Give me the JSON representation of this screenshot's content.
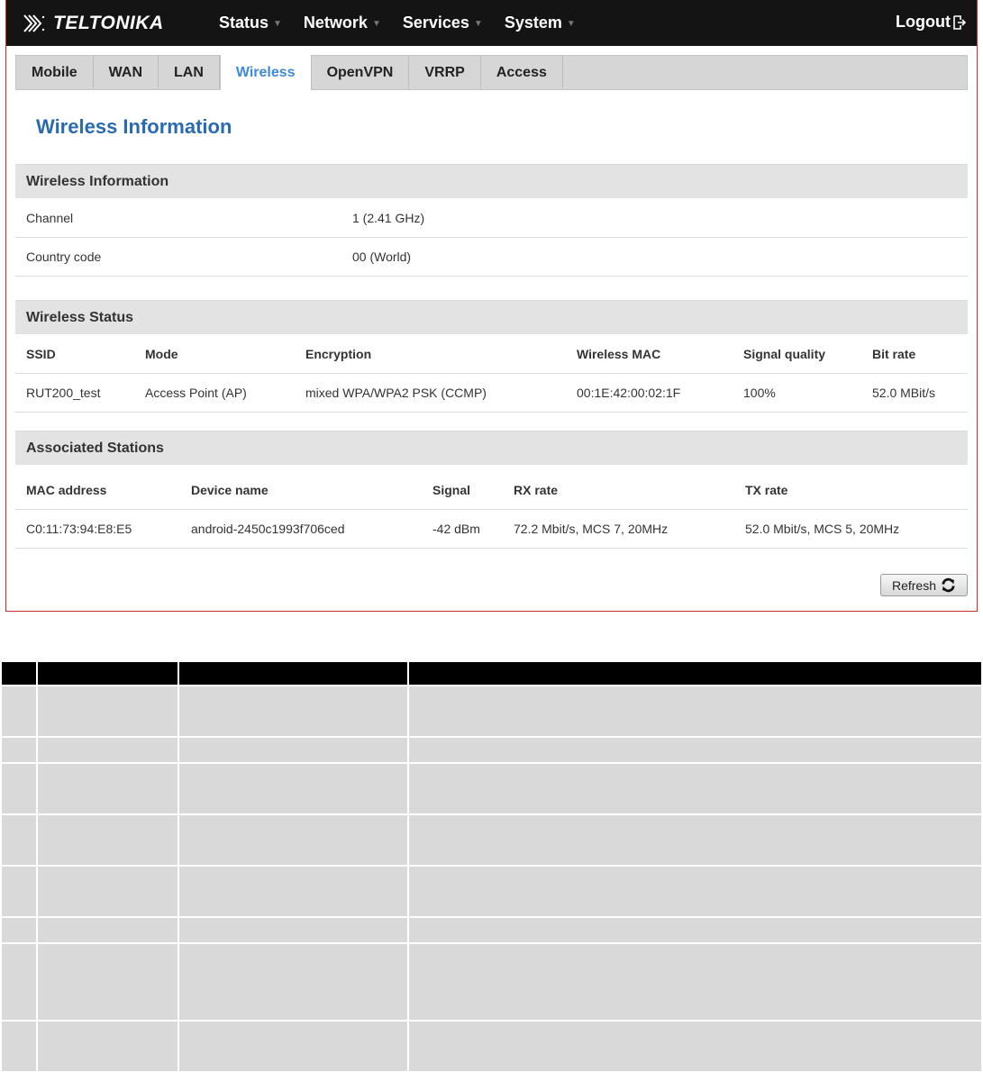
{
  "navbar": {
    "logo_text": "TELTONIKA",
    "menu": [
      {
        "label": "Status"
      },
      {
        "label": "Network"
      },
      {
        "label": "Services"
      },
      {
        "label": "System"
      }
    ],
    "logout_label": "Logout"
  },
  "tabs": [
    {
      "label": "Mobile",
      "active": false
    },
    {
      "label": "WAN",
      "active": false
    },
    {
      "label": "LAN",
      "active": false
    },
    {
      "label": "Wireless",
      "active": true
    },
    {
      "label": "OpenVPN",
      "active": false
    },
    {
      "label": "VRRP",
      "active": false
    },
    {
      "label": "Access",
      "active": false
    }
  ],
  "page_title": "Wireless Information",
  "wireless_info": {
    "heading": "Wireless Information",
    "channel_label": "Channel",
    "channel_value": "1 (2.41 GHz)",
    "country_label": "Country code",
    "country_value": "00 (World)"
  },
  "wireless_status": {
    "heading": "Wireless Status",
    "columns": [
      "SSID",
      "Mode",
      "Encryption",
      "Wireless MAC",
      "Signal quality",
      "Bit rate"
    ],
    "row": [
      "RUT200_test",
      "Access Point (AP)",
      "mixed WPA/WPA2 PSK (CCMP)",
      "00:1E:42:00:02:1F",
      "100%",
      "52.0 MBit/s"
    ]
  },
  "stations": {
    "heading": "Associated Stations",
    "columns": [
      "MAC address",
      "Device name",
      "Signal",
      "RX rate",
      "TX rate"
    ],
    "row": [
      "C0:11:73:94:E8:E5",
      "android-2450c1993f706ced",
      "-42 dBm",
      "72.2 Mbit/s, MCS 7, 20MHz",
      "52.0 Mbit/s, MCS 5, 20MHz"
    ]
  },
  "refresh_label": "Refresh",
  "colors": {
    "navbar_bg": "#141414",
    "accent_blue": "#3c8ad8",
    "title_blue": "#2a6ab3",
    "frame_border": "#c9302c"
  }
}
